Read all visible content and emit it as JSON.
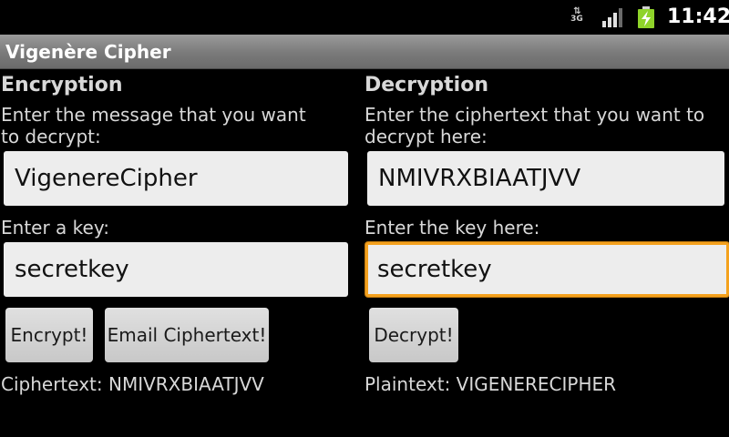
{
  "status_bar": {
    "network": "3G",
    "time": "11:42",
    "signal_icon": "signal-strength-icon",
    "battery_icon": "battery-charging-icon"
  },
  "app": {
    "title": "Vigenère Cipher"
  },
  "encryption": {
    "heading": "Encryption",
    "message_prompt": "Enter the message that you want to decrypt:",
    "message_value": "VigenereCipher",
    "key_prompt": "Enter a key:",
    "key_value": "secretkey",
    "encrypt_button": "Encrypt!",
    "email_button": "Email Ciphertext!",
    "result_text": "Ciphertext: NMIVRXBIAATJVV"
  },
  "decryption": {
    "heading": "Decryption",
    "ciphertext_prompt": "Enter the ciphertext that you want to decrypt here:",
    "ciphertext_value": "NMIVRXBIAATJVV",
    "key_prompt": "Enter the key here:",
    "key_value": "secretkey",
    "decrypt_button": "Decrypt!",
    "result_text": "Plaintext: VIGENERECIPHER"
  },
  "colors": {
    "background": "#000000",
    "title_bar": "#8a8a8a",
    "focus_border": "#f4a11d",
    "battery_green": "#8fd32a"
  }
}
